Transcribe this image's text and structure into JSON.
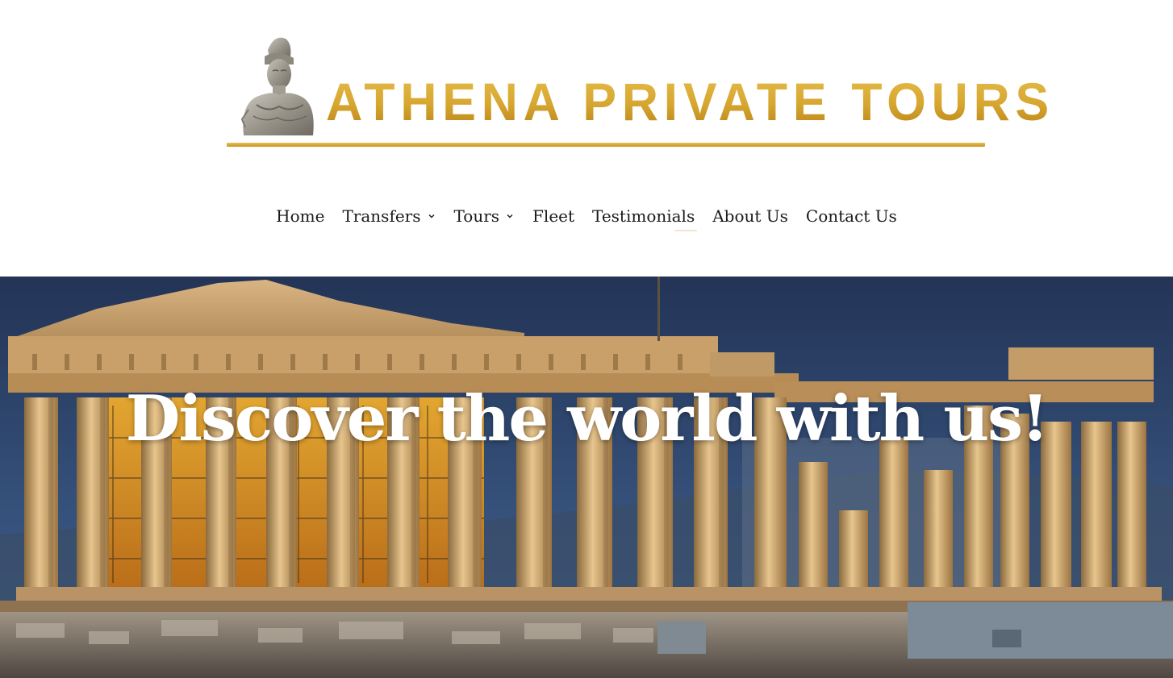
{
  "site": {
    "logo_text": "ATHENA PRIVATE TOURS",
    "brand_color": "#d2a530"
  },
  "nav": {
    "items": [
      {
        "label": "Home",
        "has_dropdown": false
      },
      {
        "label": "Transfers",
        "has_dropdown": true
      },
      {
        "label": "Tours",
        "has_dropdown": true
      },
      {
        "label": "Fleet",
        "has_dropdown": false
      },
      {
        "label": "Testimonials",
        "has_dropdown": false
      },
      {
        "label": "About Us",
        "has_dropdown": false
      },
      {
        "label": "Contact Us",
        "has_dropdown": false
      }
    ]
  },
  "hero": {
    "title": "Discover the world with us!",
    "image_icon": "parthenon-photo"
  }
}
